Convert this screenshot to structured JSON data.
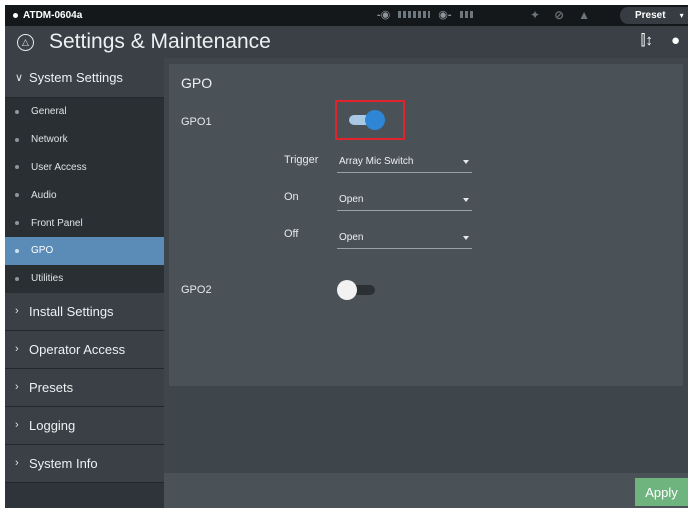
{
  "statusbar": {
    "device_name": "ATDM-0604a",
    "preset_label": "Preset",
    "icons": [
      "input-icon",
      "output-icon",
      "link-icon",
      "mic-icon",
      "warning-icon"
    ]
  },
  "header": {
    "title": "Settings & Maintenance",
    "icons": [
      "mixer-icon",
      "user-icon"
    ]
  },
  "sidebar": {
    "system_settings": {
      "label": "System Settings",
      "items": [
        "General",
        "Network",
        "User Access",
        "Audio",
        "Front Panel",
        "GPO",
        "Utilities"
      ],
      "active": "GPO"
    },
    "groups": [
      "Install Settings",
      "Operator Access",
      "Presets",
      "Logging",
      "System Info"
    ]
  },
  "main": {
    "section_title": "GPO",
    "gpo1": {
      "label": "GPO1",
      "enabled": true,
      "trigger_label": "Trigger",
      "trigger_value": "Array Mic Switch",
      "on_label": "On",
      "on_value": "Open",
      "off_label": "Off",
      "off_value": "Open"
    },
    "gpo2": {
      "label": "GPO2",
      "enabled": false
    },
    "apply_label": "Apply"
  },
  "colors": {
    "accent_blue": "#2f86d6",
    "active_nav": "#5b8cb8",
    "apply_green": "#6fb37e",
    "highlight_red": "#e0242b"
  }
}
